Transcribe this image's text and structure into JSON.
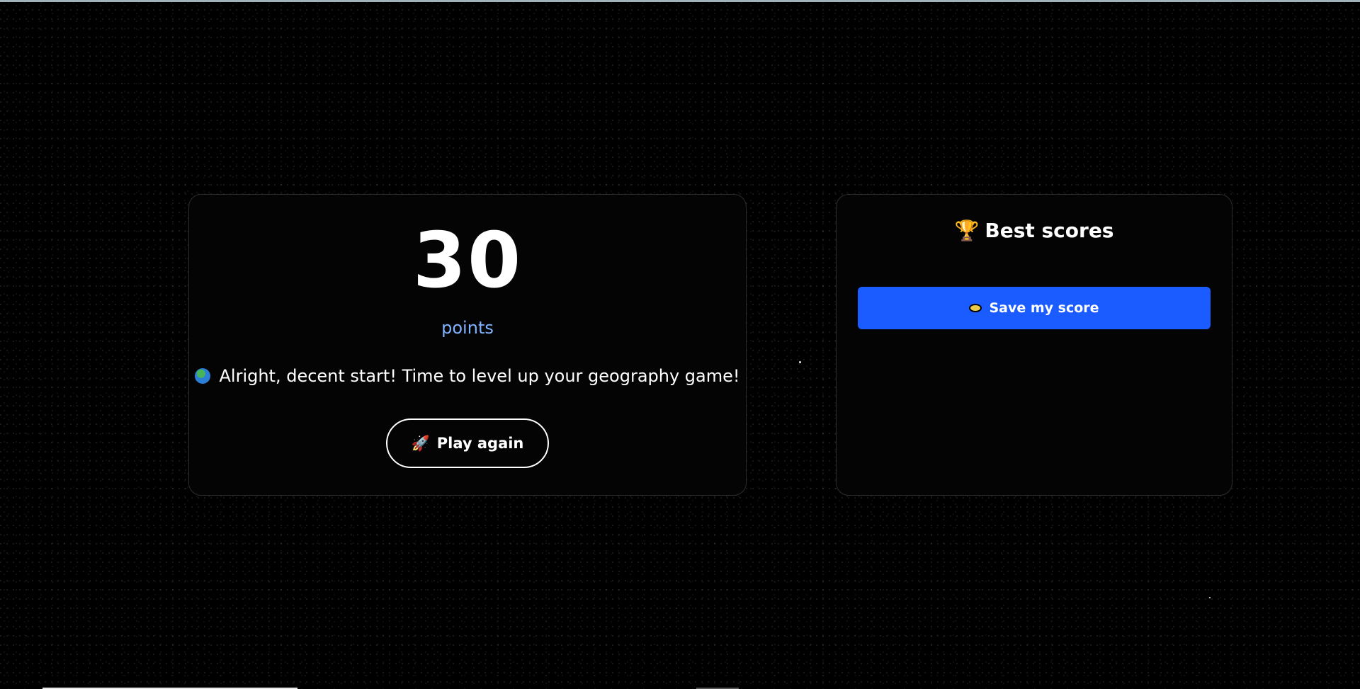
{
  "result": {
    "score": "30",
    "unit": "points",
    "message": "Alright, decent start! Time to level up your geography game!",
    "message_icon": "globe-icon",
    "play_again_label": "Play again",
    "play_again_icon": "rocket-icon"
  },
  "leaderboard": {
    "title": "Best scores",
    "title_icon": "trophy-icon",
    "save_label": "Save my score",
    "save_icon": "disk-icon"
  },
  "colors": {
    "background": "#000000",
    "accent_blue": "#1a5cff",
    "points_label": "#7fb3ff",
    "trophy": "#f5b82e"
  }
}
